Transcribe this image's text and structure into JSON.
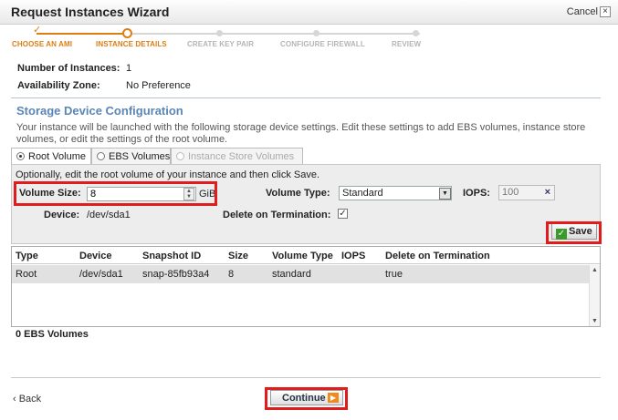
{
  "window": {
    "title": "Request Instances Wizard",
    "cancel_label": "Cancel",
    "close_glyph": "×"
  },
  "steps": [
    {
      "label": "CHOOSE AN AMI",
      "state": "done"
    },
    {
      "label": "INSTANCE DETAILS",
      "state": "current"
    },
    {
      "label": "CREATE KEY PAIR",
      "state": "pending"
    },
    {
      "label": "CONFIGURE FIREWALL",
      "state": "pending"
    },
    {
      "label": "REVIEW",
      "state": "pending"
    }
  ],
  "summary": {
    "instances_label": "Number of Instances:",
    "instances_value": "1",
    "zone_label": "Availability Zone:",
    "zone_value": "No Preference"
  },
  "storage": {
    "title": "Storage Device Configuration",
    "description": "Your instance will be launched with the following storage device settings. Edit these settings to add EBS volumes, instance store volumes, or edit the settings of the root volume.",
    "tabs": [
      {
        "label": "Root Volume",
        "selected": true,
        "enabled": true
      },
      {
        "label": "EBS Volumes",
        "selected": false,
        "enabled": true
      },
      {
        "label": "Instance Store Volumes",
        "selected": false,
        "enabled": false
      }
    ],
    "hint": "Optionally, edit the root volume of your instance and then click Save.",
    "volume_size_label": "Volume Size:",
    "volume_size_value": "8",
    "volume_size_unit": "GiB",
    "volume_type_label": "Volume Type:",
    "volume_type_value": "Standard",
    "iops_label": "IOPS:",
    "iops_value": "100",
    "device_label": "Device:",
    "device_value": "/dev/sda1",
    "delete_label": "Delete on Termination:",
    "delete_checked": true,
    "save_label": "Save"
  },
  "table": {
    "headers": [
      "Type",
      "Device",
      "Snapshot ID",
      "Size",
      "Volume Type",
      "IOPS",
      "Delete on Termination"
    ],
    "rows": [
      [
        "Root",
        "/dev/sda1",
        "snap-85fb93a4",
        "8",
        "standard",
        "",
        "true"
      ]
    ]
  },
  "ebs_count": "0 EBS Volumes",
  "footer": {
    "back_label": "‹ Back",
    "continue_label": "Continue"
  },
  "colors": {
    "accent_orange": "#e07d10",
    "section_blue": "#5a86b4",
    "highlight_red": "#e01c1c"
  }
}
